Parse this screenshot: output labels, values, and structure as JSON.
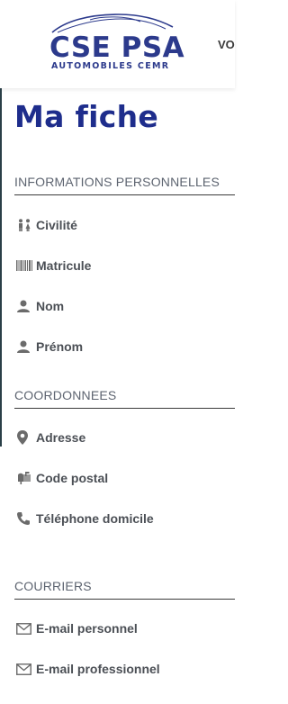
{
  "header": {
    "logo": {
      "title": "CSE PSA",
      "subtitle": "AUTOMOBILES CEMR"
    },
    "nav_peek": "VO"
  },
  "page": {
    "title": "Ma fiche"
  },
  "sections": {
    "personal": {
      "title": "INFORMATIONS PERSONNELLES",
      "fields": [
        {
          "icon": "people-icon",
          "label": "Civilité"
        },
        {
          "icon": "barcode-icon",
          "label": "Matricule"
        },
        {
          "icon": "user-icon",
          "label": "Nom"
        },
        {
          "icon": "user-icon",
          "label": "Prénom"
        }
      ]
    },
    "contact": {
      "title": "COORDONNEES",
      "fields": [
        {
          "icon": "map-marker-icon",
          "label": "Adresse"
        },
        {
          "icon": "mailbox-icon",
          "label": "Code postal"
        },
        {
          "icon": "phone-icon",
          "label": "Téléphone domicile"
        }
      ]
    },
    "mail": {
      "title": "COURRIERS",
      "fields": [
        {
          "icon": "envelope-icon",
          "label": "E-mail personnel"
        },
        {
          "icon": "envelope-icon",
          "label": "E-mail professionnel"
        }
      ]
    }
  },
  "colors": {
    "brand": "#2c3a8c",
    "title": "#1e2d8c",
    "section_text": "#5d6470",
    "label": "#4b4f55"
  }
}
